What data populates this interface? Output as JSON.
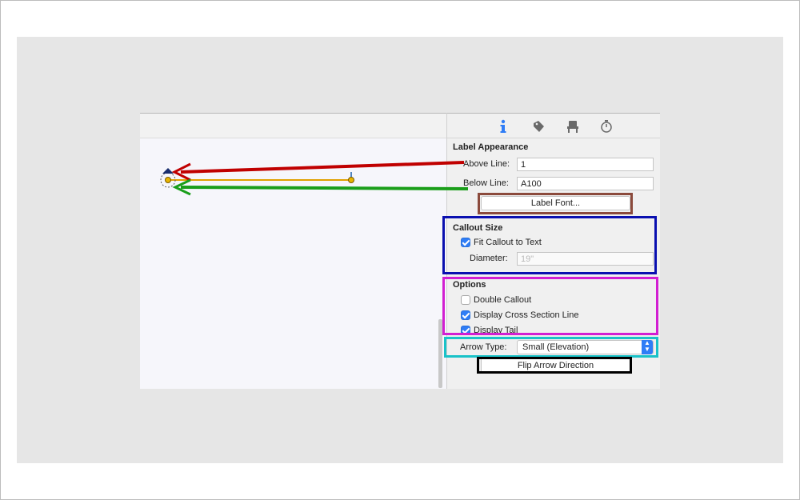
{
  "tabs": [
    {
      "icon": "info-icon"
    },
    {
      "icon": "tag-pen-icon"
    },
    {
      "icon": "chair-icon"
    },
    {
      "icon": "stopwatch-icon"
    }
  ],
  "label_appearance": {
    "title": "Label Appearance",
    "above_line_label": "Above Line:",
    "above_line_value": "1",
    "below_line_label": "Below Line:",
    "below_line_value": "A100",
    "font_button": "Label Font..."
  },
  "callout_size": {
    "title": "Callout Size",
    "fit_label": "Fit Callout to Text",
    "fit_checked": true,
    "diameter_label": "Diameter:",
    "diameter_placeholder": "19\""
  },
  "options": {
    "title": "Options",
    "items": [
      {
        "label": "Double Callout",
        "checked": false
      },
      {
        "label": "Display Cross Section Line",
        "checked": true
      },
      {
        "label": "Display Tail",
        "checked": true
      }
    ]
  },
  "arrow": {
    "label": "Arrow Type:",
    "value": "Small (Elevation)",
    "flip_button": "Flip Arrow Direction"
  },
  "colors": {
    "accent": "#2f7df6",
    "red_arrow": "#c00000",
    "green_arrow": "#1a9e1a",
    "brown_box": "#8b4a3c",
    "blue_box": "#0a10b0",
    "magenta_box": "#d21fd2",
    "cyan_box": "#19c2c8",
    "black_box": "#000000"
  }
}
